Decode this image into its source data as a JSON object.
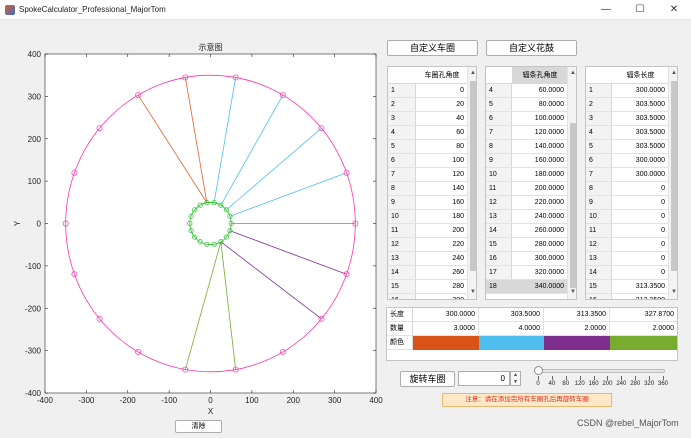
{
  "window": {
    "title": "SpokeCalculator_Professional_MajorTom",
    "minimize": "—",
    "maximize": "☐",
    "close": "✕"
  },
  "plot": {
    "title": "示意图",
    "xlabel": "X",
    "ylabel": "Y",
    "x_ticks": [
      "-400",
      "-300",
      "-200",
      "-100",
      "0",
      "100",
      "200",
      "300",
      "400"
    ],
    "y_ticks": [
      "400",
      "300",
      "200",
      "100",
      "0",
      "-100",
      "-200",
      "-300",
      "-400"
    ],
    "clear_button": "清除"
  },
  "chart_data": {
    "type": "line",
    "title": "示意图",
    "xlabel": "X",
    "ylabel": "Y",
    "xlim": [
      -400,
      400
    ],
    "ylim": [
      -400,
      400
    ],
    "grid": false,
    "rim_radius": 350,
    "rim_hole_angles_deg": [
      0,
      20,
      40,
      60,
      80,
      100,
      120,
      140,
      160,
      180,
      200,
      220,
      240,
      260,
      280,
      300,
      320,
      340
    ],
    "hub_radius": 50,
    "hub_hole_angles_deg": [
      0,
      20,
      40,
      60,
      80,
      100,
      120,
      140,
      160,
      180,
      200,
      220,
      240,
      260,
      280,
      300,
      320,
      340
    ],
    "rim_color": "#ff33aa",
    "hub_color": "#22bb22",
    "spokes": [
      {
        "rim_angle": 0,
        "hub_angle": 0,
        "color": "#e0632b"
      },
      {
        "rim_angle": 100,
        "hub_angle": 100,
        "color": "#e0632b"
      },
      {
        "rim_angle": 120,
        "hub_angle": 100,
        "color": "#e0632b"
      },
      {
        "rim_angle": 20,
        "hub_angle": 20,
        "color": "#4dbeee"
      },
      {
        "rim_angle": 40,
        "hub_angle": 40,
        "color": "#4dbeee"
      },
      {
        "rim_angle": 60,
        "hub_angle": 60,
        "color": "#4dbeee"
      },
      {
        "rim_angle": 80,
        "hub_angle": 80,
        "color": "#4dbeee"
      },
      {
        "rim_angle": 340,
        "hub_angle": 340,
        "color": "#7e2f8e"
      },
      {
        "rim_angle": 320,
        "hub_angle": 300,
        "color": "#7e2f8e"
      },
      {
        "rim_angle": 260,
        "hub_angle": 300,
        "color": "#77ac30"
      },
      {
        "rim_angle": 280,
        "hub_angle": 300,
        "color": "#77ac30"
      }
    ]
  },
  "buttons": {
    "custom_rim": "自定义车圈",
    "custom_hub": "自定义花鼓",
    "rotate_rim": "旋转车圈"
  },
  "rim_table": {
    "header": "车圈孔角度",
    "rows": [
      {
        "n": "1",
        "v": "0"
      },
      {
        "n": "2",
        "v": "20"
      },
      {
        "n": "3",
        "v": "40"
      },
      {
        "n": "4",
        "v": "60"
      },
      {
        "n": "5",
        "v": "80"
      },
      {
        "n": "6",
        "v": "100"
      },
      {
        "n": "7",
        "v": "120"
      },
      {
        "n": "8",
        "v": "140"
      },
      {
        "n": "9",
        "v": "160"
      },
      {
        "n": "10",
        "v": "180"
      },
      {
        "n": "11",
        "v": "200"
      },
      {
        "n": "12",
        "v": "220"
      },
      {
        "n": "13",
        "v": "240"
      },
      {
        "n": "14",
        "v": "260"
      },
      {
        "n": "15",
        "v": "280"
      },
      {
        "n": "16",
        "v": "300"
      }
    ]
  },
  "hub_table": {
    "header": "辐条孔角度",
    "rows": [
      {
        "n": "4",
        "v": "60.0000"
      },
      {
        "n": "5",
        "v": "80.0000"
      },
      {
        "n": "6",
        "v": "100.0000"
      },
      {
        "n": "7",
        "v": "120.0000"
      },
      {
        "n": "8",
        "v": "140.0000"
      },
      {
        "n": "9",
        "v": "160.0000"
      },
      {
        "n": "10",
        "v": "180.0000"
      },
      {
        "n": "11",
        "v": "200.0000"
      },
      {
        "n": "12",
        "v": "220.0000"
      },
      {
        "n": "13",
        "v": "240.0000"
      },
      {
        "n": "14",
        "v": "260.0000"
      },
      {
        "n": "15",
        "v": "280.0000"
      },
      {
        "n": "16",
        "v": "300.0000"
      },
      {
        "n": "17",
        "v": "320.0000"
      },
      {
        "n": "18",
        "v": "340.0000"
      }
    ]
  },
  "length_table": {
    "header": "辐条长度",
    "rows": [
      {
        "n": "1",
        "v": "300.0000"
      },
      {
        "n": "2",
        "v": "303.5000"
      },
      {
        "n": "3",
        "v": "303.5000"
      },
      {
        "n": "4",
        "v": "303.5000"
      },
      {
        "n": "5",
        "v": "303.5000"
      },
      {
        "n": "6",
        "v": "300.0000"
      },
      {
        "n": "7",
        "v": "300.0000"
      },
      {
        "n": "8",
        "v": "0"
      },
      {
        "n": "9",
        "v": "0"
      },
      {
        "n": "10",
        "v": "0"
      },
      {
        "n": "11",
        "v": "0"
      },
      {
        "n": "12",
        "v": "0"
      },
      {
        "n": "13",
        "v": "0"
      },
      {
        "n": "14",
        "v": "0"
      },
      {
        "n": "15",
        "v": "313.3500"
      },
      {
        "n": "16",
        "v": "313.3500"
      }
    ]
  },
  "stats": {
    "length_label": "长度",
    "count_label": "数量",
    "color_label": "颜色",
    "lengths": [
      "300.0000",
      "303.5000",
      "313.3500",
      "327.8700"
    ],
    "counts": [
      "3.0000",
      "4.0000",
      "2.0000",
      "2.0000"
    ],
    "colors": [
      "#d95319",
      "#4dbeee",
      "#7e2f8e",
      "#77ac30"
    ]
  },
  "rotate": {
    "value": "0",
    "slider_value": 0,
    "slider_range": [
      0,
      360
    ],
    "slider_ticks": [
      "0",
      "40",
      "80",
      "120",
      "160",
      "200",
      "240",
      "280",
      "320",
      "360"
    ]
  },
  "notice": "注意：请在添加完所有车圈孔后再旋转车圈",
  "watermark": "CSDN @rebel_MajorTom"
}
